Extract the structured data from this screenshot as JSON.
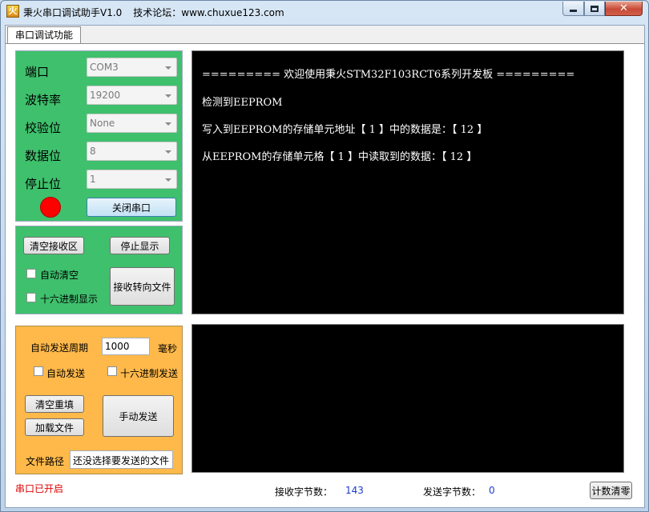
{
  "window": {
    "title": "秉火串口调试助手V1.0",
    "forum": "技术论坛：www.chuxue123.com",
    "icon": "app-icon"
  },
  "tabs": [
    {
      "label": "串口调试功能"
    }
  ],
  "serial": {
    "port_label": "端口",
    "port_value": "COM3",
    "baud_label": "波特率",
    "baud_value": "19200",
    "parity_label": "校验位",
    "parity_value": "None",
    "databits_label": "数据位",
    "databits_value": "8",
    "stopbits_label": "停止位",
    "stopbits_value": "1",
    "status_led_color": "#ff0000",
    "close_button": "关闭串口"
  },
  "receive": {
    "clear_button": "清空接收区",
    "stop_button": "停止显示",
    "auto_clear_label": "自动清空",
    "hex_display_label": "十六进制显示",
    "redirect_button": "接收转向文件",
    "lines": [
      "========= 欢迎使用秉火STM32F103RCT6系列开发板 =========",
      "检测到EEPROM",
      "写入到EEPROM的存储单元地址【 1 】中的数据是：【 12 】",
      "从EEPROM的存储单元格【 1 】中读取到的数据：【 12 】"
    ]
  },
  "send": {
    "period_label": "自动发送周期",
    "period_value": "1000",
    "period_unit": "毫秒",
    "auto_send_label": "自动发送",
    "hex_send_label": "十六进制发送",
    "clear_button": "清空重填",
    "load_file_button": "加载文件",
    "manual_send_button": "手动发送",
    "file_path_label": "文件路径",
    "file_path_value": "还没选择要发送的文件"
  },
  "status": {
    "port_status": "串口已开启",
    "rx_label": "接收字节数：",
    "rx_count": "143",
    "tx_label": "发送字节数：",
    "tx_count": "0",
    "reset_button": "计数清零"
  }
}
